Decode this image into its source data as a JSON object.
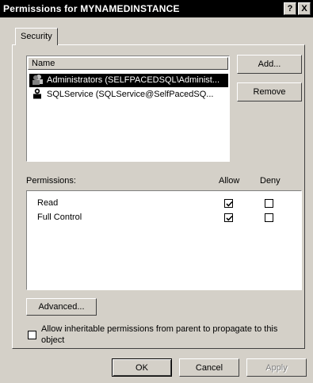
{
  "window": {
    "title": "Permissions for MYNAMEDINSTANCE",
    "help_btn": "?",
    "close_btn": "X"
  },
  "tab": {
    "label": "Security"
  },
  "names_list": {
    "header": "Name",
    "items": [
      {
        "label": "Administrators (SELFPACEDSQL\\Administ...",
        "selected": true,
        "icon": "group-user-icon"
      },
      {
        "label": "SQLService (SQLService@SelfPacedSQ...",
        "selected": false,
        "icon": "user-icon"
      }
    ]
  },
  "buttons": {
    "add": "Add...",
    "remove": "Remove",
    "advanced": "Advanced...",
    "ok": "OK",
    "cancel": "Cancel",
    "apply": "Apply"
  },
  "permissions": {
    "header": "Permissions:",
    "allow_header": "Allow",
    "deny_header": "Deny",
    "rows": [
      {
        "label": "Read",
        "allow": true,
        "deny": false
      },
      {
        "label": "Full Control",
        "allow": true,
        "deny": false
      }
    ]
  },
  "inherit": {
    "line1": "Allow inheritable permissions from parent to propagate to this",
    "line2": "object",
    "checked": false
  }
}
